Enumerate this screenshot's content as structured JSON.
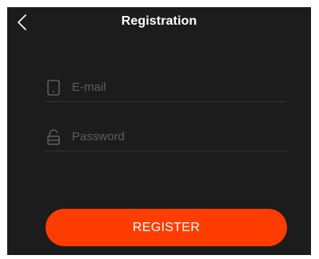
{
  "header": {
    "back_icon": "chevron-left-icon",
    "title": "Registration"
  },
  "form": {
    "email": {
      "icon": "phone-icon",
      "placeholder": "E-mail",
      "value": ""
    },
    "password": {
      "icon": "lock-icon",
      "placeholder": "Password",
      "value": ""
    },
    "register_label": "REGISTER"
  },
  "colors": {
    "background": "#1c1c1c",
    "accent": "#ff3d00",
    "placeholder": "#5e5e5e",
    "divider": "#333333"
  }
}
